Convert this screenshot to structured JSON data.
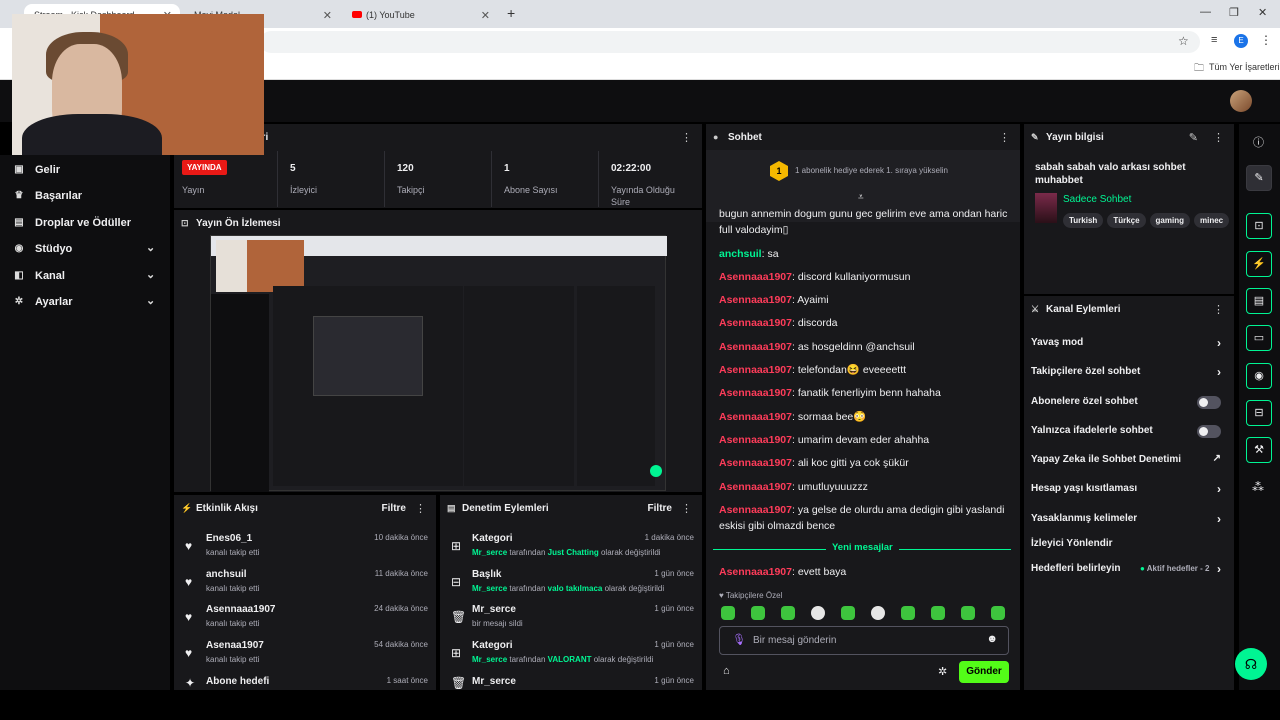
{
  "browser": {
    "tabs": [
      {
        "label": "Stream - Kick Dashboard"
      },
      {
        "label": "Mavi Model"
      },
      {
        "label": "(1) YouTube"
      }
    ],
    "new_tab": "+",
    "bookmark_folder": "Tüm Yer İşaretleri",
    "profile_initial": "E"
  },
  "sidebar": {
    "items": [
      {
        "label": "Gelir",
        "icon": "wallet-icon"
      },
      {
        "label": "Başarılar",
        "icon": "trophy-icon"
      },
      {
        "label": "Droplar ve Ödüller",
        "icon": "gift-icon"
      },
      {
        "label": "Stüdyo",
        "icon": "studio-icon"
      },
      {
        "label": "Kanal",
        "icon": "channel-icon"
      },
      {
        "label": "Ayarlar",
        "icon": "gear-icon"
      }
    ]
  },
  "stats_panel": {
    "title": "eri",
    "live_badge": "YAYINDA",
    "stats": [
      {
        "value": "",
        "label": "Yayın"
      },
      {
        "value": "5",
        "label": "İzleyici"
      },
      {
        "value": "120",
        "label": "Takipçi"
      },
      {
        "value": "1",
        "label": "Abone Sayısı"
      },
      {
        "value": "02:22:00",
        "label": "Yayında Olduğu Süre"
      }
    ]
  },
  "preview": {
    "title": "Yayın Ön İzlemesi"
  },
  "activity": {
    "title": "Etkinlik Akışı",
    "filter": "Filtre",
    "items": [
      {
        "name": "Enes06_1",
        "sub": "kanalı takip etti",
        "time": "10 dakika önce"
      },
      {
        "name": "anchsuil",
        "sub": "kanalı takip etti",
        "time": "11 dakika önce"
      },
      {
        "name": "Asennaaa1907",
        "sub": "kanalı takip etti",
        "time": "24 dakika önce"
      },
      {
        "name": "Asenaa1907",
        "sub": "kanalı takip etti",
        "time": "54 dakika önce"
      },
      {
        "name": "Abone hedefi",
        "sub": "",
        "time": "1 saat önce"
      }
    ]
  },
  "moderation": {
    "title": "Denetim Eylemleri",
    "filter": "Filtre",
    "items": [
      {
        "name": "Kategori",
        "user": "Mr_serce",
        "mid": "tarafından",
        "value": "Just Chatting",
        "end": "olarak değiştirildi",
        "time": "1 dakika önce"
      },
      {
        "name": "Başlık",
        "user": "Mr_serce",
        "mid": "tarafından",
        "value": "valo takılmaca",
        "end": "olarak değiştirildi",
        "time": "1 gün önce"
      },
      {
        "name": "Mr_serce",
        "user": "",
        "mid": "bir mesajı sildi",
        "value": "",
        "end": "",
        "time": "1 gün önce"
      },
      {
        "name": "Kategori",
        "user": "Mr_serce",
        "mid": "tarafından",
        "value": "VALORANT",
        "end": "olarak değiştirildi",
        "time": "1 gün önce"
      },
      {
        "name": "Mr_serce",
        "user": "",
        "mid": "",
        "value": "",
        "end": "",
        "time": "1 gün önce"
      }
    ]
  },
  "chat": {
    "title": "Sohbet",
    "pinned": "1 abonelik hediye ederek 1. sıraya yükselin",
    "pinned_rank": "1",
    "messages": [
      {
        "user": "",
        "text": "bugun annemin dogum gunu gec gelirim eve ama ondan haric full valodayim▯",
        "color": "none"
      },
      {
        "user": "anchsuil",
        "text": "sa",
        "color": "green"
      },
      {
        "user": "Asennaaa1907",
        "text": "discord kullaniyormusun",
        "color": "red"
      },
      {
        "user": "Asennaaa1907",
        "text": "Ayaimi",
        "color": "red"
      },
      {
        "user": "Asennaaa1907",
        "text": "discorda",
        "color": "red"
      },
      {
        "user": "Asennaaa1907",
        "text": "as hosgeldinn @anchsuil",
        "color": "red"
      },
      {
        "user": "Asennaaa1907",
        "text": "telefondan😆 eveeeettt",
        "color": "red"
      },
      {
        "user": "Asennaaa1907",
        "text": "fanatik fenerliyim benn hahaha",
        "color": "red"
      },
      {
        "user": "Asennaaa1907",
        "text": "sormaa bee😳",
        "color": "red"
      },
      {
        "user": "Asennaaa1907",
        "text": "umarim devam eder ahahha",
        "color": "red"
      },
      {
        "user": "Asennaaa1907",
        "text": "ali koc gitti ya cok şükür",
        "color": "red"
      },
      {
        "user": "Asennaaa1907",
        "text": "umutluyuuuzzz",
        "color": "red"
      },
      {
        "user": "Asennaaa1907",
        "text": "ya gelse de olurdu ama dedigin gibi yaslandi eskisi gibi olmazdi bence",
        "color": "red"
      }
    ],
    "new_messages": "Yeni mesajlar",
    "last_message": {
      "user": "Asennaaa1907",
      "text": "evett baya"
    },
    "mode_label": "Takipçilere Özel",
    "input_placeholder": "Bir mesaj gönderin",
    "send": "Gönder"
  },
  "stream_info": {
    "title": "Yayın bilgisi",
    "stream_title": "sabah sabah valo arkası sohbet muhabbet",
    "category": "Sadece Sohbet",
    "tags": [
      "Turkish",
      "Türkçe",
      "gaming",
      "minec"
    ]
  },
  "channel_actions": {
    "title": "Kanal Eylemleri",
    "items": [
      {
        "label": "Yavaş mod",
        "kind": "arrow"
      },
      {
        "label": "Takipçilere özel sohbet",
        "kind": "arrow"
      },
      {
        "label": "Abonelere özel sohbet",
        "kind": "toggle"
      },
      {
        "label": "Yalnızca ifadelerle sohbet",
        "kind": "toggle"
      },
      {
        "label": "Yapay Zeka ile Sohbet Denetimi",
        "kind": "external"
      },
      {
        "label": "Hesap yaşı kısıtlaması",
        "kind": "arrow"
      },
      {
        "label": "Yasaklanmış kelimeler",
        "kind": "arrow"
      },
      {
        "label": "İzleyici Yönlendir",
        "kind": "none"
      },
      {
        "label": "Hedefleri belirleyin",
        "kind": "arrow"
      }
    ],
    "goals_status": "Aktif hedefler - 2"
  },
  "colors": {
    "accent": "#00f593",
    "live": "#e91916",
    "username": "#ff3c5a"
  }
}
